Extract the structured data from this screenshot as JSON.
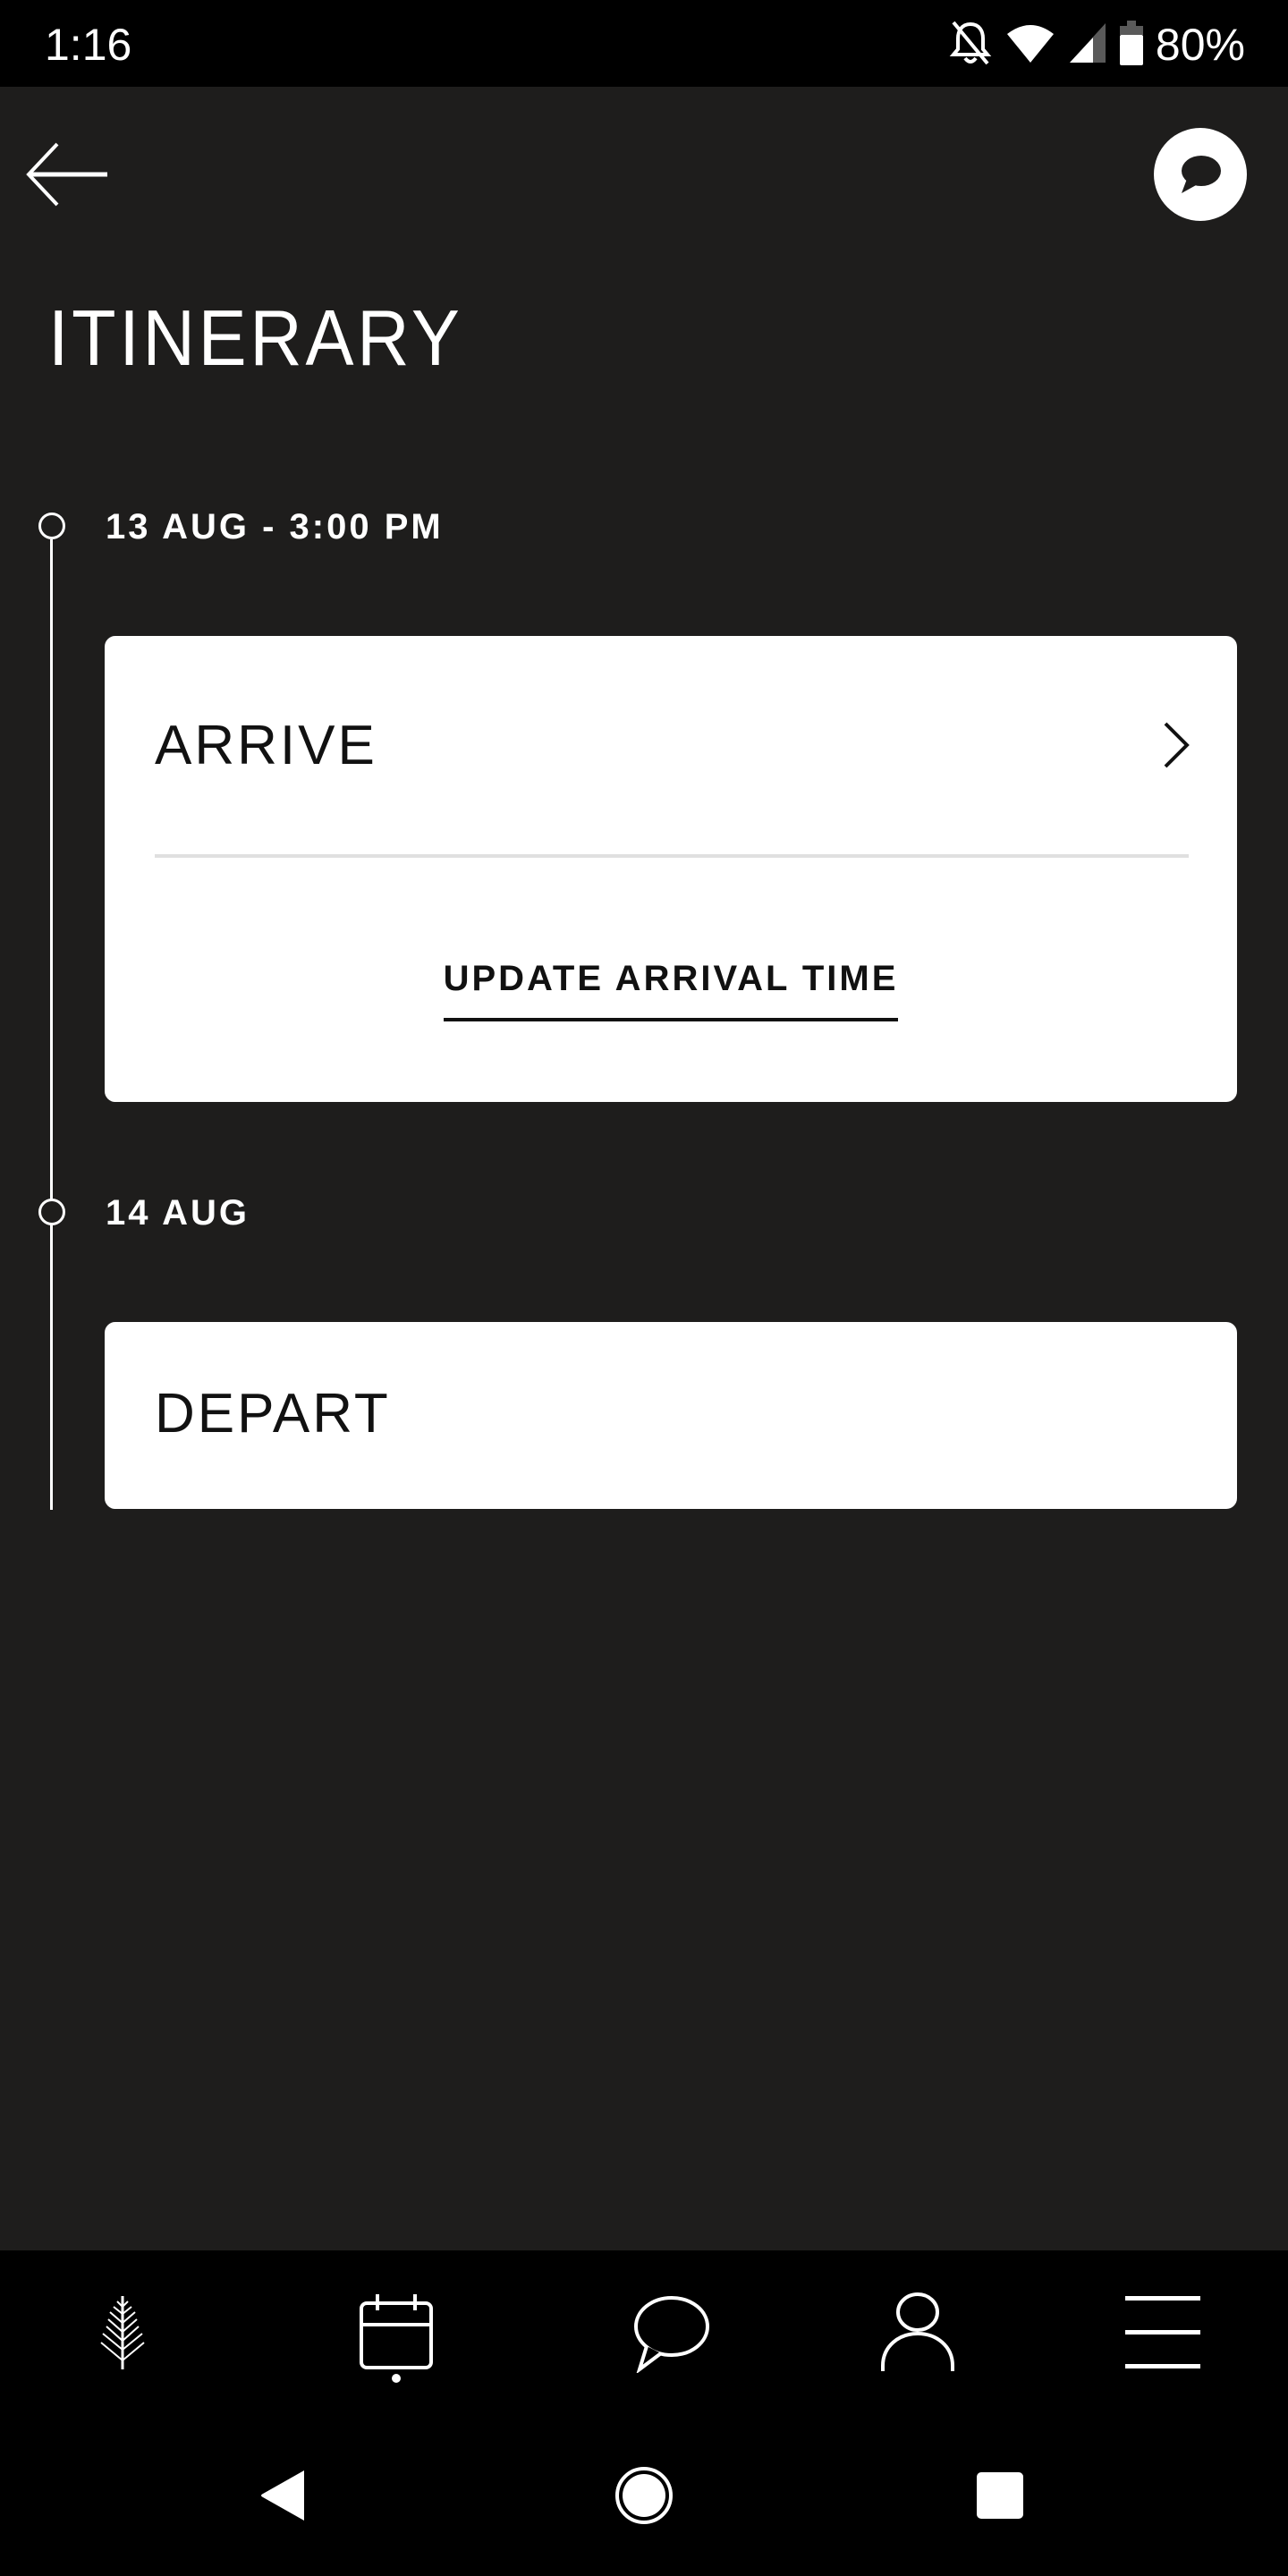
{
  "status_bar": {
    "time": "1:16",
    "battery": "80%",
    "icons": [
      "notifications-off-icon",
      "wifi-icon",
      "cellular-signal-icon",
      "battery-icon"
    ]
  },
  "header": {
    "back_icon": "arrow-left-icon",
    "chat_icon": "chat-bubble-icon",
    "title": "ITINERARY"
  },
  "timeline": [
    {
      "date": "13 AUG - 3:00 PM",
      "card": {
        "title": "ARRIVE",
        "has_chevron": true,
        "action_label": "UPDATE ARRIVAL TIME"
      }
    },
    {
      "date": "14 AUG",
      "card": {
        "title": "DEPART",
        "has_chevron": false
      }
    }
  ],
  "bottom_nav": {
    "items": [
      {
        "name": "home",
        "icon": "tree-logo-icon"
      },
      {
        "name": "itinerary",
        "icon": "calendar-icon",
        "active": true
      },
      {
        "name": "chat",
        "icon": "chat-bubble-icon"
      },
      {
        "name": "profile",
        "icon": "person-icon"
      },
      {
        "name": "menu",
        "icon": "hamburger-menu-icon"
      }
    ]
  },
  "system_nav": {
    "items": [
      "back-triangle-icon",
      "home-circle-icon",
      "recents-square-icon"
    ]
  },
  "colors": {
    "background": "#1e1d1c",
    "card": "#ffffff",
    "text_on_dark": "#ffffff",
    "text_on_card": "#111111",
    "divider": "#e0e0e0",
    "bars": "#000000"
  }
}
